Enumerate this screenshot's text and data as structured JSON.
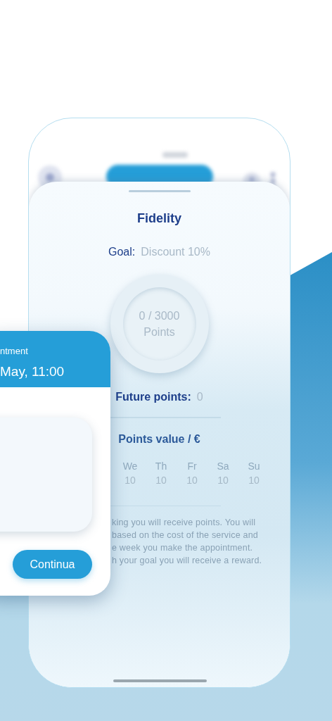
{
  "sheet": {
    "title": "Fidelity",
    "goal": {
      "label": "Goal:",
      "value": "Discount 10%"
    },
    "progress": {
      "count": "0 / 3000",
      "unit": "Points"
    },
    "future_points": {
      "label": "Future points:",
      "value": "0"
    },
    "points_value": {
      "title": "Points value / €",
      "days": [
        {
          "day": "We",
          "value": "10"
        },
        {
          "day": "Th",
          "value": "10"
        },
        {
          "day": "Fr",
          "value": "10"
        },
        {
          "day": "Sa",
          "value": "10"
        },
        {
          "day": "Su",
          "value": "10"
        }
      ]
    },
    "info_lines": [
      "king you will receive points. You will",
      "based on the cost of the service and",
      "e week you make the appointment.",
      "h your goal you will receive a reward."
    ]
  },
  "appointment_card": {
    "header_label": "ntment",
    "header_date": "May, 11:00",
    "button": "Continua"
  }
}
